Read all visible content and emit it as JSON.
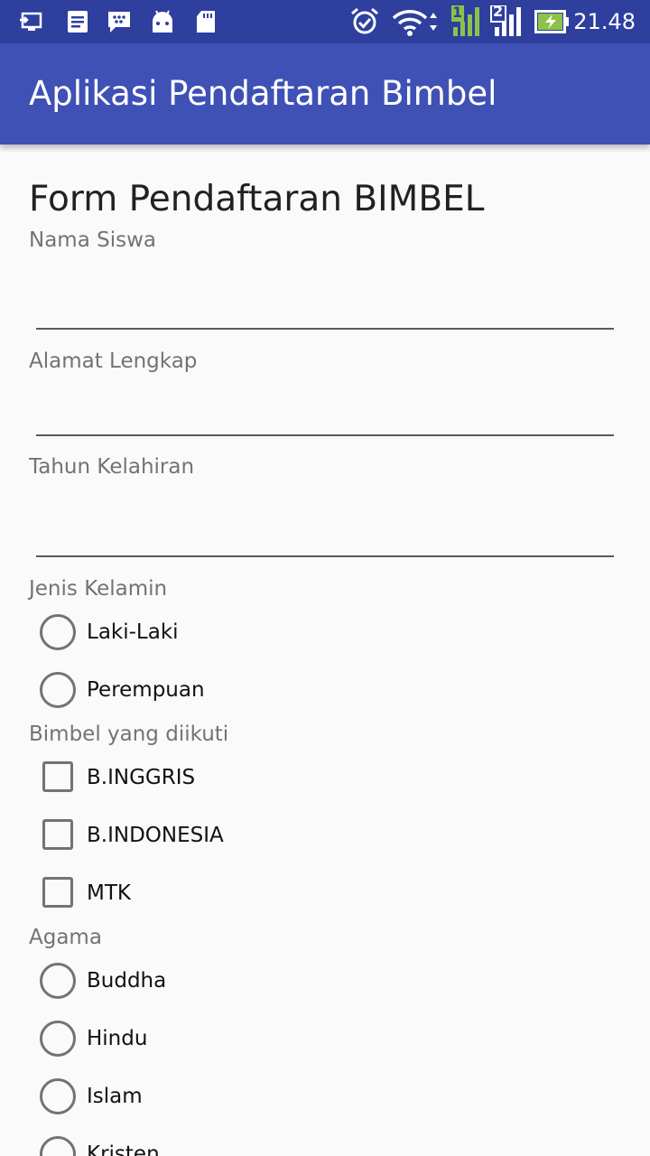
{
  "status_bar": {
    "time": "21.48",
    "sim1": "1",
    "sim2": "2",
    "icons": [
      "screen-cast-icon",
      "notes-icon",
      "bbm-icon",
      "android-icon",
      "sd-card-icon",
      "alarm-icon",
      "wifi-icon",
      "signal-sim1-icon",
      "signal-sim2-icon",
      "battery-charging-icon"
    ]
  },
  "app_bar": {
    "title": "Aplikasi Pendaftaran Bimbel",
    "color": "#3f51b5"
  },
  "form": {
    "title": "Form Pendaftaran BIMBEL",
    "nama_label": "Nama Siswa",
    "nama_value": "",
    "alamat_label": "Alamat Lengkap",
    "alamat_value": "",
    "tahun_label": "Tahun Kelahiran",
    "tahun_value": "",
    "gender_label": "Jenis Kelamin",
    "gender_options": [
      "Laki-Laki",
      "Perempuan"
    ],
    "bimbel_label": "Bimbel yang diikuti",
    "bimbel_options": [
      "B.INGGRIS",
      "B.INDONESIA",
      "MTK"
    ],
    "agama_label": "Agama",
    "agama_options": [
      "Buddha",
      "Hindu",
      "Islam",
      "Kristen"
    ]
  }
}
